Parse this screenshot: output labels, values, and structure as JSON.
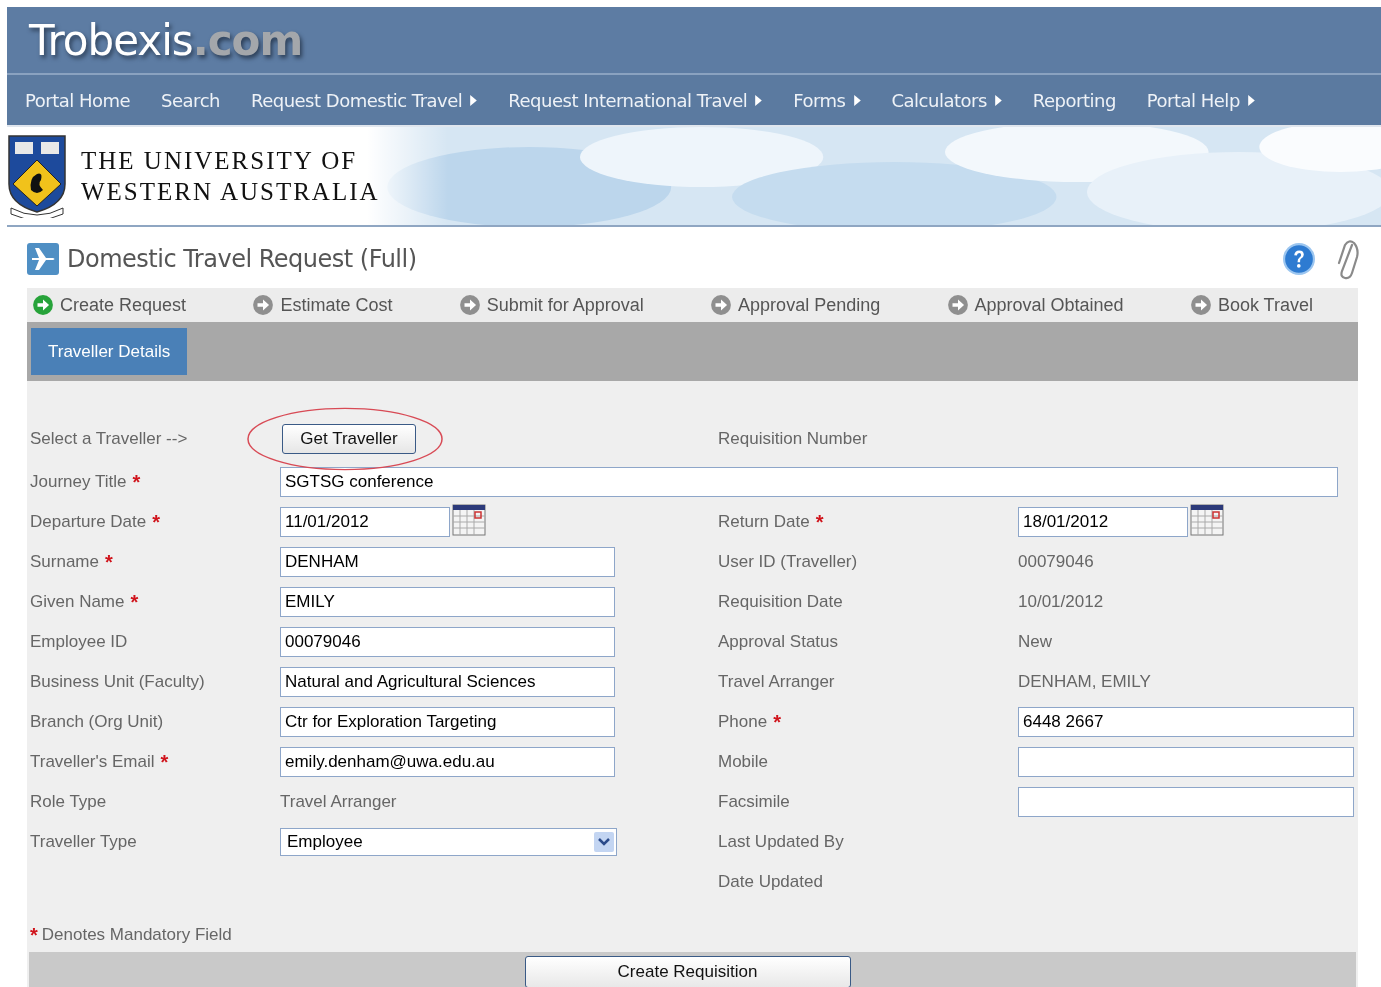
{
  "brand": {
    "name": "Trobexis",
    "suffix": ".com"
  },
  "nav": [
    {
      "label": "Portal Home",
      "has_submenu": false
    },
    {
      "label": "Search",
      "has_submenu": false
    },
    {
      "label": "Request Domestic Travel",
      "has_submenu": true
    },
    {
      "label": "Request International Travel",
      "has_submenu": true
    },
    {
      "label": "Forms",
      "has_submenu": true
    },
    {
      "label": "Calculators",
      "has_submenu": true
    },
    {
      "label": "Reporting",
      "has_submenu": false
    },
    {
      "label": "Portal Help",
      "has_submenu": true
    }
  ],
  "banner": {
    "lines": [
      "THE UNIVERSITY OF",
      "WESTERN AUSTRALIA"
    ]
  },
  "page_title": "Domestic Travel Request (Full)",
  "steps": [
    {
      "label": "Create Request",
      "selected": true
    },
    {
      "label": "Estimate Cost",
      "selected": false
    },
    {
      "label": "Submit for Approval",
      "selected": false
    },
    {
      "label": "Approval Pending",
      "selected": false
    },
    {
      "label": "Approval Obtained",
      "selected": false
    },
    {
      "label": "Book Travel",
      "selected": false
    }
  ],
  "tabs": [
    {
      "label": "Traveller Details",
      "selected": true
    }
  ],
  "form": {
    "rows": [
      {
        "left": {
          "label": "Select a Traveller -->",
          "kind": "button",
          "value": "Get Traveller",
          "circled": true
        },
        "right": {
          "label": "Requisition Number",
          "kind": "none"
        }
      },
      {
        "left": {
          "label": "Journey Title",
          "mark": "*",
          "kind": "wide_input",
          "value": "SGTSG conference"
        }
      },
      {
        "left": {
          "label": "Departure Date",
          "mark": "*",
          "kind": "date",
          "value": "11/01/2012"
        },
        "right": {
          "label": "Return Date",
          "mark": "*",
          "kind": "date",
          "value": "18/01/2012"
        }
      },
      {
        "left": {
          "label": "Surname",
          "mark": "*",
          "kind": "input",
          "value": "DENHAM"
        },
        "right": {
          "label": "User ID (Traveller)",
          "kind": "text",
          "value": "00079046"
        }
      },
      {
        "left": {
          "label": "Given Name",
          "mark": "*",
          "kind": "input",
          "value": "EMILY"
        },
        "right": {
          "label": "Requisition Date",
          "kind": "text",
          "value": "10/01/2012"
        }
      },
      {
        "left": {
          "label": "Employee ID",
          "kind": "input",
          "value": "00079046"
        },
        "right": {
          "label": "Approval Status",
          "kind": "text",
          "value": "New"
        }
      },
      {
        "left": {
          "label": "Business Unit (Faculty)",
          "kind": "input",
          "value": "Natural and Agricultural Sciences"
        },
        "right": {
          "label": "Travel Arranger",
          "kind": "text",
          "value": "DENHAM, EMILY"
        }
      },
      {
        "left": {
          "label": "Branch (Org Unit)",
          "kind": "input",
          "value": "Ctr for Exploration Targeting"
        },
        "right": {
          "label": "Phone",
          "mark": "*",
          "kind": "input",
          "value": "6448 2667"
        }
      },
      {
        "left": {
          "label": "Traveller's Email",
          "mark": "*",
          "kind": "input",
          "value": "emily.denham@uwa.edu.au"
        },
        "right": {
          "label": "Mobile",
          "kind": "input"
        }
      },
      {
        "left": {
          "label": "Role Type",
          "kind": "text",
          "value": "Travel Arranger"
        },
        "right": {
          "label": "Facsimile",
          "kind": "input"
        }
      },
      {
        "left": {
          "label": "Traveller Type",
          "kind": "select",
          "value": "Employee"
        },
        "right": {
          "label": "Last Updated By",
          "kind": "none"
        }
      },
      {
        "right": {
          "label": "Date Updated",
          "kind": "none"
        }
      }
    ],
    "note": {
      "mark": "*",
      "text": "Denotes Mandatory Field"
    },
    "submit": "Create Requisition"
  }
}
